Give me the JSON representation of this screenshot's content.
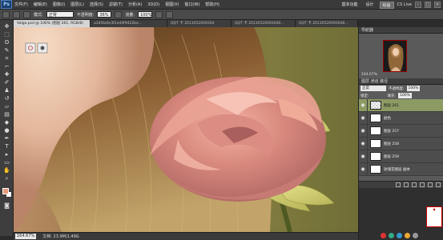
{
  "app": {
    "logo": "Ps"
  },
  "menu": [
    "文件(F)",
    "编辑(E)",
    "图像(I)",
    "图层(L)",
    "选择(S)",
    "滤镜(T)",
    "分析(A)",
    "3D(D)",
    "视图(V)",
    "窗口(W)",
    "帮助(H)"
  ],
  "workspace": {
    "buttons": [
      "基本功能",
      "设计",
      "绘画"
    ],
    "active_index": 2,
    "cs_live": "CS Live"
  },
  "options": {
    "mode_label": "模式:",
    "mode_value": "正常",
    "opacity_label": "不透明度:",
    "opacity_value": "36%",
    "flow_label": "流量:",
    "flow_value": "100%"
  },
  "tabs": [
    "Valga.psd @ 100% (图层 261, RGB/8)",
    "a34f4a0e3f2ed4f9422be...",
    "QQT 卡 2013052009204",
    "QQT 卡 20130520092040...",
    "QQT 卡 20130520092048..."
  ],
  "active_tab": 0,
  "status": {
    "zoom": "164.67%",
    "doc": "文档: 23.9M/1.49G"
  },
  "navigator": {
    "title": "导航器",
    "zoom": "164.67%"
  },
  "layers": {
    "tabs": "图层 通道 路径",
    "blend_mode": "正常",
    "opacity_label": "不透明度:",
    "opacity_value": "100%",
    "fill_label": "填充:",
    "fill_value": "100%",
    "lock_label": "锁定:",
    "items": [
      {
        "name": "图层 261",
        "selected": true,
        "thumb": "checker"
      },
      {
        "name": "颜色",
        "selected": false,
        "thumb": "white"
      },
      {
        "name": "图层 257",
        "selected": false,
        "thumb": "white"
      },
      {
        "name": "图层 258",
        "selected": false,
        "thumb": "white"
      },
      {
        "name": "图层 259",
        "selected": false,
        "thumb": "white"
      },
      {
        "name": "玫瑰花图层 副本",
        "selected": false,
        "thumb": "white"
      }
    ]
  },
  "colors": {
    "foreground": "#e79a7c",
    "background": "#ffffff",
    "selected_layer": "#8c9a63"
  }
}
